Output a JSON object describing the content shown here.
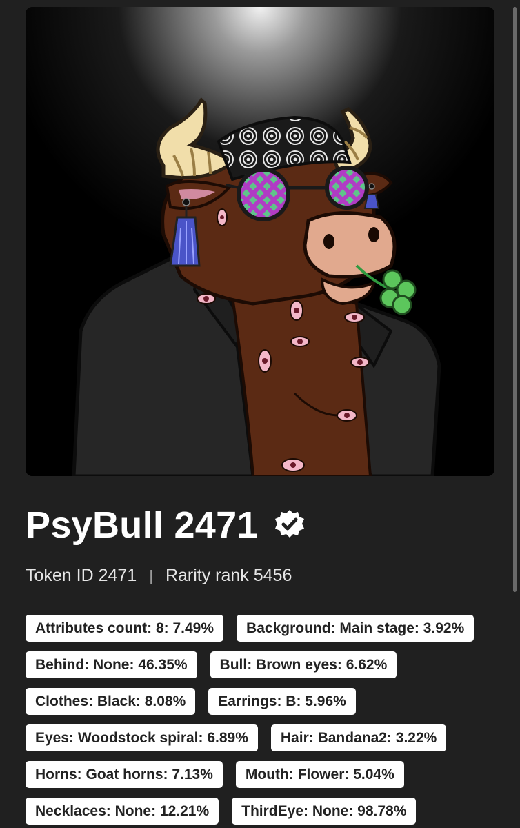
{
  "nft": {
    "title": "PsyBull 2471",
    "token_id": "Token ID 2471",
    "separator": "|",
    "rarity": "Rarity rank 5456",
    "verified": true
  },
  "attributes": [
    "Attributes count: 8: 7.49%",
    "Background: Main stage: 3.92%",
    "Behind: None: 46.35%",
    "Bull: Brown eyes: 6.62%",
    "Clothes: Black: 8.08%",
    "Earrings: B: 5.96%",
    "Eyes: Woodstock spiral: 6.89%",
    "Hair: Bandana2: 3.22%",
    "Horns: Goat horns: 7.13%",
    "Mouth: Flower: 5.04%",
    "Necklaces: None: 12.21%",
    "ThirdEye: None: 98.78%"
  ],
  "colors": {
    "page_background": "#202020",
    "chip_background": "#ffffff",
    "chip_text": "#222222",
    "bull_fur": "#5b2a14",
    "jacket": "#262626",
    "eyeglass_green": "#5fc48a",
    "eyeglass_magenta": "#b03cc4"
  }
}
